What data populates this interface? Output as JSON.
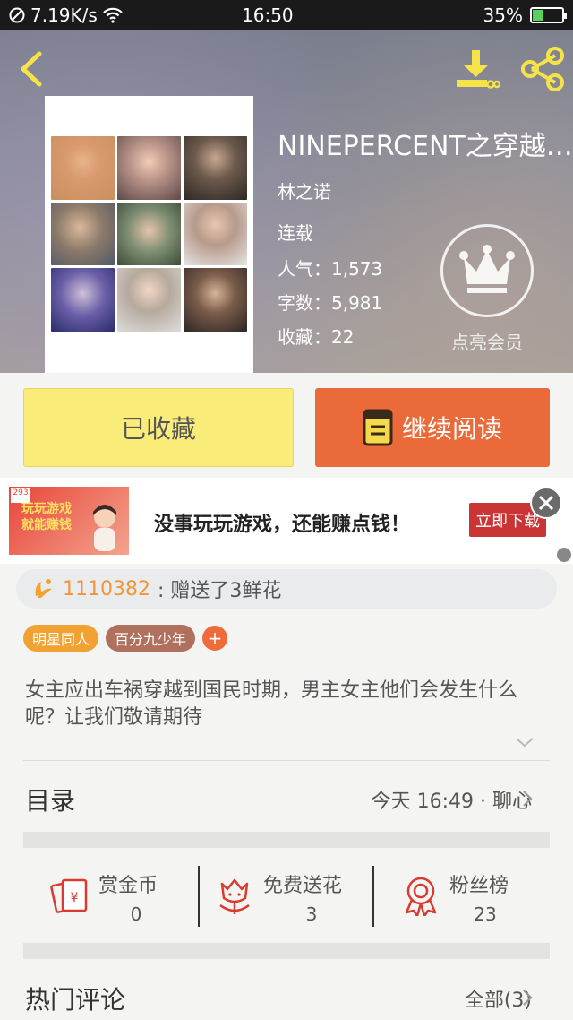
{
  "status_bar": {
    "network_speed": "7.19K/s",
    "time": "16:50",
    "battery": "35%",
    "battery_level": 0.35,
    "icons": [
      "dnd-icon",
      "wifi-icon",
      "battery-icon"
    ]
  },
  "header": {
    "icons": [
      "back-icon",
      "download-icon",
      "share-icon"
    ]
  },
  "book": {
    "title": "NINEPERCENT之穿越…",
    "author": "林之诺",
    "status": "连载",
    "popularity": "人气：1,573",
    "word_count": "字数：5,981",
    "favorites": "收藏：22"
  },
  "vip": {
    "label": "点亮会员",
    "icon": "crown-icon"
  },
  "actions": {
    "collected_label": "已收藏",
    "continue_label": "继续阅读",
    "continue_icon": "book-icon"
  },
  "ad": {
    "thumb_text": "玩玩游戏\n就能赚钱",
    "text": "没事玩玩游戏，还能赚点钱！",
    "button_label": "立即下载",
    "icon": "close-icon"
  },
  "gift_notice": {
    "user": "1110382",
    "text": ": 赠送了3鲜花",
    "icon": "flower-icon"
  },
  "tags": {
    "items": [
      "明星同人",
      "百分九少年"
    ],
    "add_label": "+"
  },
  "description": {
    "text": "女主应出车祸穿越到国民时期，男主女主他们会发生什么呢？让我们敬请期待",
    "icon": "chevron-down-icon"
  },
  "catalog": {
    "label": "目录",
    "latest": "今天 16:49 · 聊心",
    "icon": "chevron-right-icon"
  },
  "stats": {
    "reward": {
      "label": "赏金币",
      "value": "0",
      "icon": "red-envelope-icon"
    },
    "flowers": {
      "label": "免费送花",
      "value": "3",
      "icon": "flower-icon"
    },
    "fans": {
      "label": "粉丝榜",
      "value": "23",
      "icon": "medal-icon"
    }
  },
  "comments": {
    "label": "热门评论",
    "all_label": "全部(3)",
    "icon": "chevron-right-icon"
  },
  "colors": {
    "accent_orange": "#ea6a39",
    "accent_yellow": "#f9ec79",
    "icon_yellow": "#f4e44a",
    "icon_red": "#d93b2e"
  }
}
